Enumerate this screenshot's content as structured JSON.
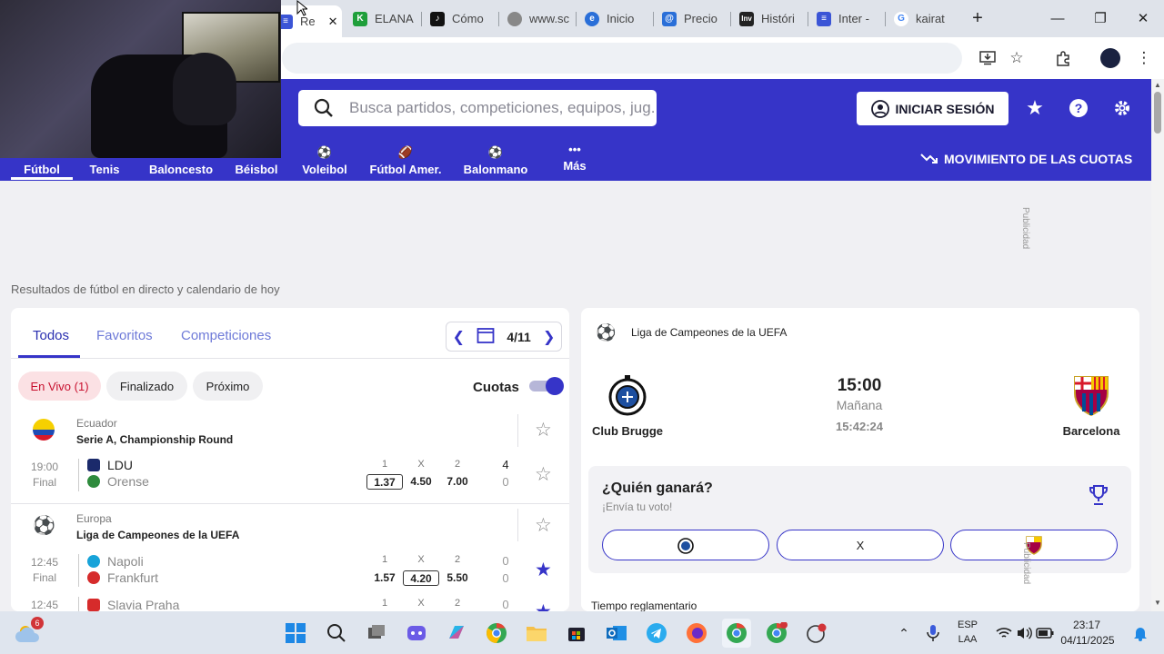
{
  "browser": {
    "tabs": [
      {
        "label": "Re",
        "color": "#3b55d6",
        "glyph": "≡",
        "active": true
      },
      {
        "label": "ELANA",
        "color": "#1f9f3b",
        "glyph": "K"
      },
      {
        "label": "Cómo",
        "color": "#111111",
        "glyph": "♪"
      },
      {
        "label": "www.sc",
        "color": "#777777",
        "glyph": "◎"
      },
      {
        "label": "Inicio",
        "color": "#2a6fd8",
        "glyph": "@"
      },
      {
        "label": "Precio",
        "color": "#2a6fd8",
        "glyph": "@"
      },
      {
        "label": "Históri",
        "color": "#222222",
        "glyph": "Inv"
      },
      {
        "label": "Inter -",
        "color": "#3b55d6",
        "glyph": "≡"
      },
      {
        "label": "kairat",
        "color": "#4285f4",
        "glyph": "G"
      }
    ],
    "new_tab": "+",
    "minimize": "—",
    "maximize": "❐",
    "close": "✕"
  },
  "header": {
    "search_placeholder": "Busca partidos, competiciones, equipos, jug...",
    "login_label": "INICIAR SESIÓN",
    "odds_movement_label": "MOVIMIENTO DE LAS CUOTAS",
    "sports": [
      {
        "label": "Fútbol",
        "icon": "⚽"
      },
      {
        "label": "Tenis",
        "icon": "●"
      },
      {
        "label": "Baloncesto",
        "icon": "●"
      },
      {
        "label": "Béisbol",
        "icon": "●"
      },
      {
        "label": "Voleibol",
        "icon": "⚽"
      },
      {
        "label": "Fútbol Amer.",
        "icon": "🏈"
      },
      {
        "label": "Balonmano",
        "icon": "⚽"
      },
      {
        "label": "Más",
        "icon": "•••"
      }
    ]
  },
  "ad_label": "Publicidad",
  "page_subtitle": "Resultados de fútbol en directo y calendario de hoy",
  "left": {
    "tabs": [
      "Todos",
      "Favoritos",
      "Competiciones"
    ],
    "date": "4/11",
    "chips": [
      "En Vivo (1)",
      "Finalizado",
      "Próximo"
    ],
    "odds_toggle_label": "Cuotas",
    "competitions": [
      {
        "region": "Ecuador",
        "name": "Serie A, Championship Round",
        "matches": [
          {
            "time": "19:00",
            "status": "Final",
            "home": "LDU",
            "away": "Orense",
            "odds_headers": [
              "1",
              "X",
              "2"
            ],
            "odds": [
              "1.37",
              "4.50",
              "7.00"
            ],
            "home_score": "4",
            "away_score": "0",
            "fav": false
          }
        ]
      },
      {
        "region": "Europa",
        "name": "Liga de Campeones de la UEFA",
        "matches": [
          {
            "time": "12:45",
            "status": "Final",
            "home": "Napoli",
            "away": "Frankfurt",
            "odds_headers": [
              "1",
              "X",
              "2"
            ],
            "odds": [
              "1.57",
              "4.20",
              "5.50"
            ],
            "home_score": "0",
            "away_score": "0",
            "fav": true
          },
          {
            "time": "12:45",
            "home": "Slavia Praha",
            "odds_headers": [
              "1",
              "X",
              "2"
            ],
            "home_score": "0"
          }
        ]
      }
    ]
  },
  "right": {
    "competition": "Liga de Campeones de la UEFA",
    "home_team": "Club Brugge",
    "away_team": "Barcelona",
    "kickoff": "15:00",
    "day": "Mañana",
    "countdown": "15:42:24",
    "vote_title": "¿Quién ganará?",
    "vote_subtitle": "¡Envía tu voto!",
    "vote_draw": "X",
    "regular_time": "Tiempo reglamentario"
  },
  "taskbar": {
    "weather_badge": "6",
    "lang_line1": "ESP",
    "lang_line2": "LAA",
    "time": "23:17",
    "date": "04/11/2025"
  },
  "colors": {
    "brand": "#3634c8",
    "live": "#c8102e"
  }
}
